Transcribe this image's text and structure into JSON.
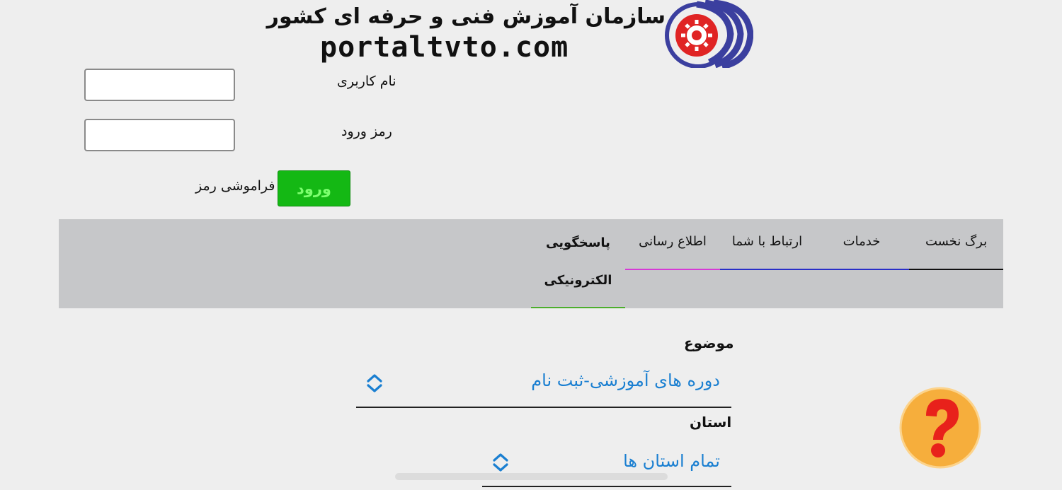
{
  "header": {
    "org_name": "سازمان آموزش فنی و حرفه ای کشور",
    "site_url": "portaltvto.com",
    "logo_icon": "tvto-gear-logo"
  },
  "login": {
    "username_label": "نام کاربری",
    "username_value": "",
    "password_label": "رمز ورود",
    "password_value": "",
    "submit_label": "ورود",
    "forgot_label": "فراموشی رمز"
  },
  "nav": {
    "items": [
      {
        "label": "برگ نخست",
        "underline": "#111111"
      },
      {
        "label": "خدمات",
        "underline": "#2a2fc8"
      },
      {
        "label": "ارتباط با شما",
        "underline": "#2a2fc8"
      },
      {
        "label": "اطلاع رسانی",
        "underline": "#d63ad6"
      },
      {
        "label": "پاسخگویی الکترونیکی",
        "underline": "#4cae2c"
      }
    ]
  },
  "form": {
    "subject_label": "موضوع",
    "subject_value": "دوره های آموزشی-ثبت نام",
    "province_label": "استان",
    "province_value": "تمام استان ها"
  },
  "colors": {
    "accent_link": "#1a7fd1",
    "login_button": "#14b814",
    "navbar_bg": "#c6c7c9"
  },
  "help": {
    "icon": "question-mark-icon"
  }
}
